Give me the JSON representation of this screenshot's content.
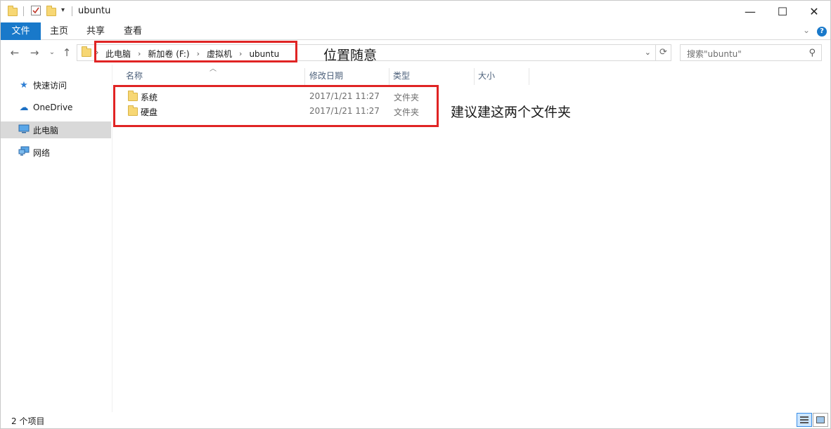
{
  "window": {
    "title": "ubuntu",
    "controls": {
      "minimize": "—",
      "maximize": "☐",
      "close": "✕"
    }
  },
  "ribbon": {
    "tabs": [
      "文件",
      "主页",
      "共享",
      "查看"
    ]
  },
  "address": {
    "crumbs": [
      "此电脑",
      "新加卷 (F:)",
      "虚拟机",
      "ubuntu"
    ],
    "separator": "›"
  },
  "search": {
    "placeholder": "搜索\"ubuntu\""
  },
  "nav_pane": {
    "items": [
      {
        "label": "快速访问",
        "icon": "star-icon"
      },
      {
        "label": "OneDrive",
        "icon": "cloud-icon"
      },
      {
        "label": "此电脑",
        "icon": "computer-icon"
      },
      {
        "label": "网络",
        "icon": "network-icon"
      }
    ]
  },
  "columns": [
    "名称",
    "修改日期",
    "类型",
    "大小"
  ],
  "files": [
    {
      "name": "系统",
      "modified": "2017/1/21 11:27",
      "type": "文件夹"
    },
    {
      "name": "硬盘",
      "modified": "2017/1/21 11:27",
      "type": "文件夹"
    }
  ],
  "annotations": {
    "location_note": "位置随意",
    "folders_note": "建议建这两个文件夹"
  },
  "status": {
    "item_count": "2 个项目"
  },
  "colors": {
    "accent": "#1979ca",
    "annotation_red": "#e02424"
  }
}
